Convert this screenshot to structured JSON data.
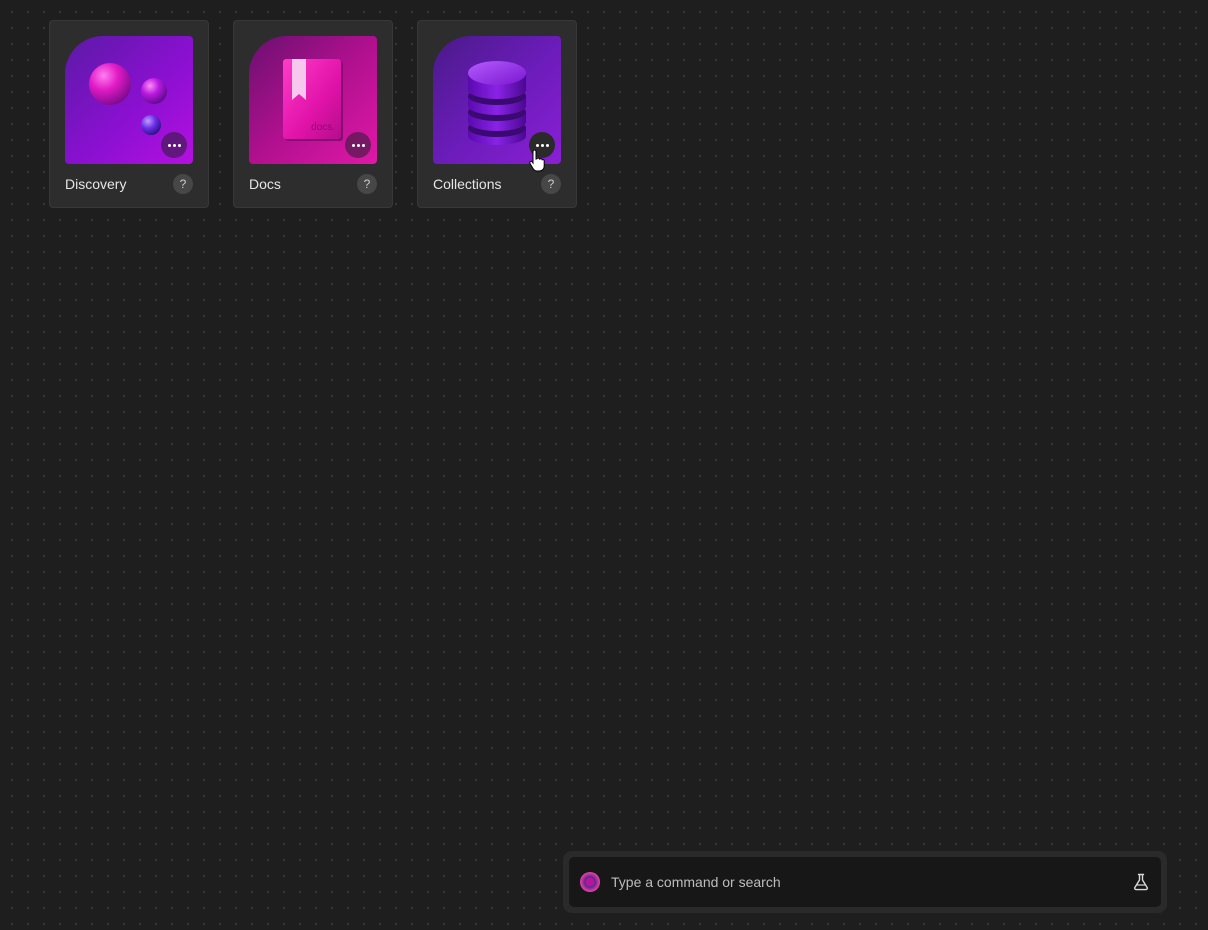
{
  "tiles": [
    {
      "label": "Discovery",
      "help": "?"
    },
    {
      "label": "Docs",
      "help": "?",
      "thumb_text": "docs."
    },
    {
      "label": "Collections",
      "help": "?"
    }
  ],
  "command": {
    "placeholder": "Type a command or search"
  },
  "colors": {
    "background": "#1e1e1e",
    "tile": "#2d2d2d",
    "accent_purple": "#8a1fd6",
    "accent_magenta": "#e010a8"
  },
  "icons": {
    "more": "more-horizontal-icon",
    "help": "help-icon",
    "logo": "app-logo-icon",
    "lab": "flask-icon"
  }
}
